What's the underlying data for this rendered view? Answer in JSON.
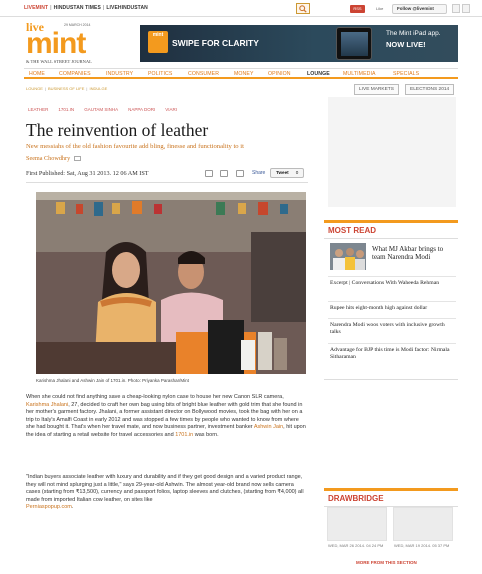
{
  "topbar": {
    "links": [
      "LIVEMINT",
      "HINDUSTAN TIMES",
      "LIVEHINDUSTAN"
    ],
    "rss_label": "RSS",
    "like_label": "Like",
    "follow_label": "Follow @livemint"
  },
  "logo": {
    "live": "live",
    "mint": "mint",
    "date": "29 MARCH 2014",
    "wsj": "& THE WALL STREET JOURNAL"
  },
  "banner": {
    "badge": "mint",
    "swipe": "SWIPE FOR CLARITY",
    "app_line1": "The Mint iPad app.",
    "app_line2": "NOW LIVE!"
  },
  "nav": {
    "items": [
      "HOME",
      "COMPANIES",
      "INDUSTRY",
      "POLITICS",
      "CONSUMER",
      "MONEY",
      "OPINION",
      "LOUNGE",
      "MULTIMEDIA",
      "SPECIALS"
    ],
    "active": "LOUNGE"
  },
  "subnav": [
    "LOUNGE",
    "BUSINESS OF LIFE",
    "INDULGE"
  ],
  "pills": {
    "markets": "LIVE MARKETS",
    "elections": "ELECTIONS 2014"
  },
  "article": {
    "tags": [
      "LEATHER",
      "1701.IN",
      "GAUTAM SINHA",
      "NAPPA DORI",
      "VIARI"
    ],
    "headline": "The reinvention of leather",
    "dek": "New messiahs of the old fashion favourite add bling, finesse and functionality to it",
    "byline": "Seema Chowdhry",
    "published": "First Published: Sat, Aug 31 2013. 12 06 AM IST",
    "share_label": "Share",
    "tweet_label": "Tweet",
    "tweet_count": "0",
    "caption": "Karishma Jhalani and Ashwin Jain of 1701.in. Photo: Priyanka Parashar/Mint",
    "p1_a": "When she could not find anything save a cheap-looking nylon case to house her new Canon SLR camera, ",
    "p1_link1": "Karishma Jhalani",
    "p1_b": ", 27, decided to craft her own bag using bits of bright blue leather with gold trim that she found in her mother's garment factory. Jhalani, a former assistant director on Bollywood movies, took the bag with her on a trip to Italy's Amalfi Coast in early 2012 and was stopped a few times by people who wanted to know from where she had bought it. That's when her travel mate, and now business partner, investment banker ",
    "p1_link2": "Ashwin Jain",
    "p1_c": ", hit upon the idea of starting a retail website for travel accessories and ",
    "p1_link3": "1701.in",
    "p1_d": " was born.",
    "p2": "\"Indian buyers associate leather with luxury and durability and if they get good design and a varied product range, they will not mind splurging just a little,\" says 29-year-old Ashwin. The almost year-old brand now sells camera cases (starting from ₹13,500), currency and passport folios, laptop sleeves and clutches, (starting from ₹4,000) all made from imported Italian cow leather, on sites like",
    "p2_link": "Perniaspopup.com",
    "p2_end": "."
  },
  "most_read": {
    "title": "MOST READ",
    "lead": "What MJ Akbar brings to team Narendra Modi",
    "items": [
      "Excerpt | Conversations With Waheeda Rehman",
      "Rupee hits eight-month high against dollar",
      "Narendra Modi woos voters with inclusive growth talks",
      "Advantage for BJP this time is Modi factor: Nirmala Sitharaman"
    ]
  },
  "drawbridge": {
    "title": "DRAWBRIDGE",
    "dates": [
      "WED, MAR 26 2014. 04 24 PM",
      "WED, MAR 19 2014. 05 37 PM"
    ],
    "more": "MORE FROM THIS SECTION"
  },
  "colors": {
    "accent": "#f39a1e",
    "link": "#c9731d",
    "red": "#cc4433"
  }
}
